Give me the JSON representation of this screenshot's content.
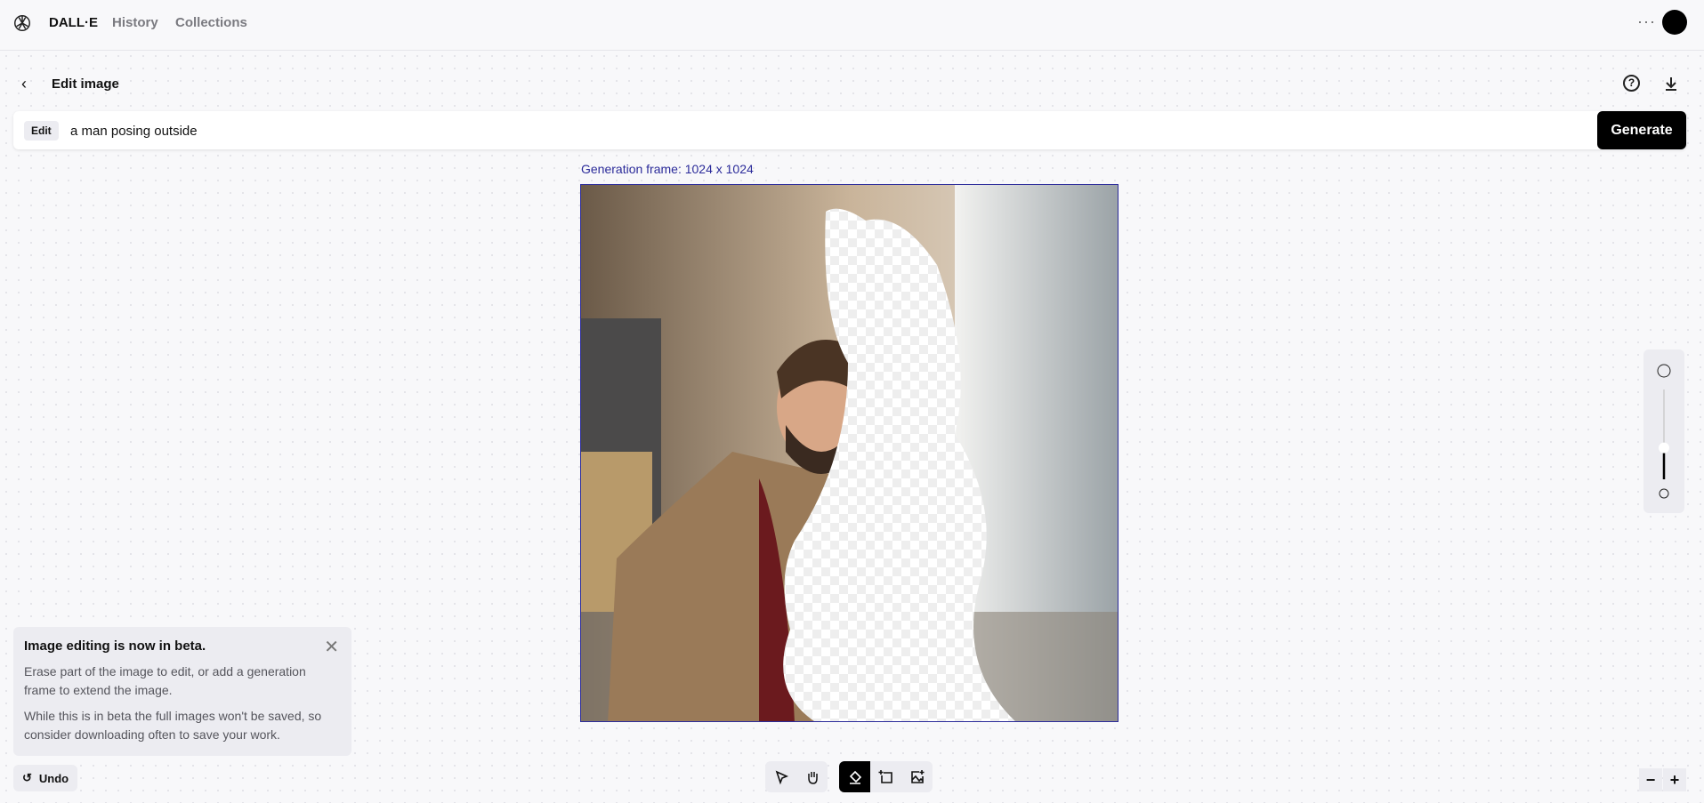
{
  "header": {
    "brand": "DALL·E",
    "nav": [
      {
        "label": "History"
      },
      {
        "label": "Collections"
      }
    ],
    "more_icon": "ellipsis-icon"
  },
  "page": {
    "title": "Edit image"
  },
  "prompt": {
    "mode_tag": "Edit",
    "value": "a man posing outside",
    "generate_label": "Generate"
  },
  "canvas": {
    "frame_label": "Generation frame: 1024 x 1024"
  },
  "beta_notice": {
    "title": "Image editing is now in beta.",
    "body1": "Erase part of the image to edit, or add a generation frame to extend the image.",
    "body2": "While this is in beta the full images won't be saved, so consider downloading often to save your work."
  },
  "undo_label": "Undo",
  "toolbar": {
    "tools": [
      "select-icon",
      "pan-hand-icon",
      "eraser-icon",
      "add-frame-icon",
      "upload-image-icon"
    ],
    "active": "eraser-icon"
  },
  "brush_size": {
    "level_percent": 35
  },
  "zoom": {
    "minus": "−",
    "plus": "+"
  }
}
